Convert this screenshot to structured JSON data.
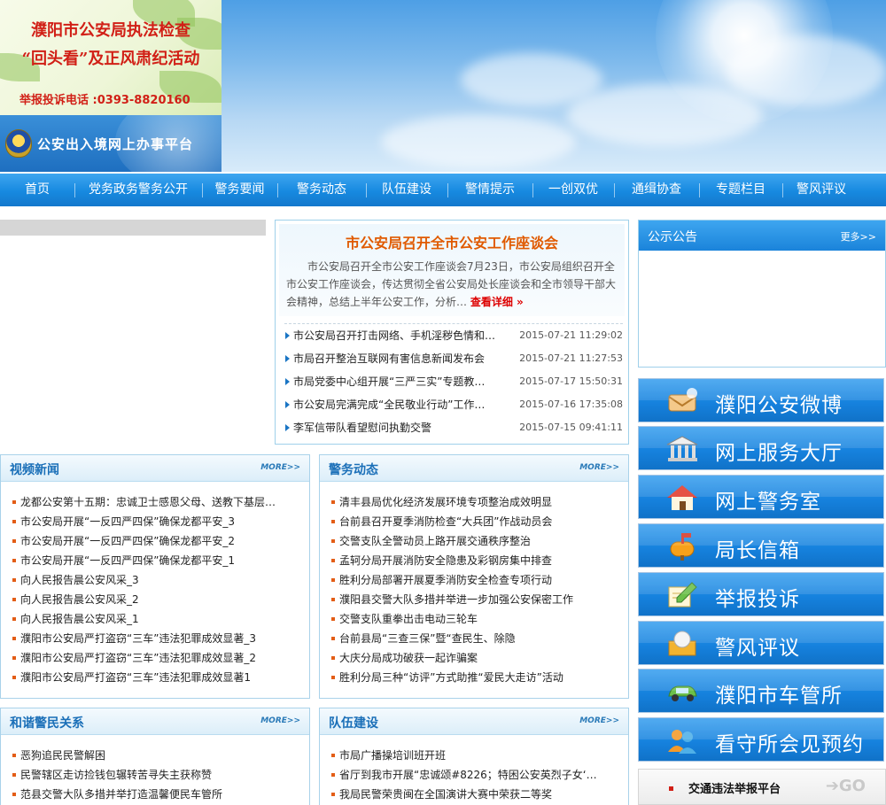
{
  "banner": {
    "line1": "濮阳市公安局执法检查",
    "line2": "“回头看”及正风肃纪活动",
    "phone": "举报投诉电话 :0393-8820160",
    "exit_entry": "公安出入境网上办事平台"
  },
  "nav": [
    "首页",
    "党务政务警务公开",
    "警务要闻",
    "警务动态",
    "队伍建设",
    "警情提示",
    "一创双优",
    "通缉协查",
    "专题栏目",
    "警风评议"
  ],
  "headline": {
    "title": "市公安局召开全市公安工作座谈会",
    "summary": "市公安局召开全市公安工作座谈会7月23日，市公安局组织召开全市公安工作座谈会，传达贯彻全省公安局处长座谈会和全市领导干部大会精神，总结上半年公安工作，分析…",
    "more": "查看详细",
    "items": [
      {
        "title": "市公安局召开打击网络、手机淫秽色情和…",
        "date": "2015-07-21 11:29:02"
      },
      {
        "title": "市局召开整治互联网有害信息新闻发布会",
        "date": "2015-07-21 11:27:53"
      },
      {
        "title": "市局党委中心组开展“三严三实”专题教…",
        "date": "2015-07-17 15:50:31"
      },
      {
        "title": "市公安局完满完成“全民敬业行动”工作…",
        "date": "2015-07-16 17:35:08"
      },
      {
        "title": "李军信带队看望慰问执勤交警",
        "date": "2015-07-15 09:41:11"
      }
    ]
  },
  "notice": {
    "title": "公示公告",
    "more": "更多>>"
  },
  "more_label": "MORE>>",
  "services": [
    {
      "label": "濮阳公安微博",
      "icon": "weibo-icon",
      "glyph": "✉",
      "color": "#f1c27d"
    },
    {
      "label": "网上服务大厅",
      "icon": "building-icon",
      "glyph": "🏛",
      "color": "#e8e8e8"
    },
    {
      "label": "网上警务室",
      "icon": "house-icon",
      "glyph": "⌂",
      "color": "#fff3d6"
    },
    {
      "label": "局长信箱",
      "icon": "mailbox-icon",
      "glyph": "✉",
      "color": "#f7a11a"
    },
    {
      "label": "举报投诉",
      "icon": "pen-icon",
      "glyph": "✎",
      "color": "#f9e6a2"
    },
    {
      "label": "警风评议",
      "icon": "comment-icon",
      "glyph": "✍",
      "color": "#f3b32e"
    },
    {
      "label": "濮阳市车管所",
      "icon": "car-icon",
      "glyph": "🚗",
      "color": "#6cc04a"
    },
    {
      "label": "看守所会见预约",
      "icon": "people-icon",
      "glyph": "👥",
      "color": "#f39a2a"
    }
  ],
  "traffic": {
    "label": "交通违法举报平台",
    "go": "➔GO"
  },
  "video_news": {
    "title": "视频新闻",
    "items": [
      "龙都公安第十五期：忠诚卫士感恩父母、送教下基层…",
      "市公安局开展“一反四严四保”确保龙都平安_3",
      "市公安局开展“一反四严四保”确保龙都平安_2",
      "市公安局开展“一反四严四保”确保龙都平安_1",
      "向人民报告晨公安风采_3",
      "向人民报告晨公安风采_2",
      "向人民报告晨公安风采_1",
      "濮阳市公安局严打盗窃“三车”违法犯罪成效显著_3",
      "濮阳市公安局严打盗窃“三车”违法犯罪成效显著_2",
      "濮阳市公安局严打盗窃“三车”违法犯罪成效显著1"
    ]
  },
  "police_news": {
    "title": "警务动态",
    "items": [
      "清丰县局优化经济发展环境专项整治成效明显",
      "台前县召开夏季消防检查“大兵团”作战动员会",
      "交警支队全警动员上路开展交通秩序整治",
      "孟轲分局开展消防安全隐患及彩钢房集中排查",
      "胜利分局部署开展夏季消防安全检查专项行动",
      "濮阳县交警大队多措并举进一步加强公安保密工作",
      "交警支队重拳出击电动三轮车",
      "台前县局“三查三保”暨“查民生、除隐",
      "大庆分局成功破获一起诈骗案",
      "胜利分局三种“访评”方式助推“爱民大走访”活动"
    ]
  },
  "harmony": {
    "title": "和谐警民关系",
    "items": [
      "恶狗追民民警解困",
      "民警辖区走访捡钱包辗转苦寻失主获称赞",
      "范县交警大队多措并举打造温馨便民车管所"
    ]
  },
  "team": {
    "title": "队伍建设",
    "items": [
      "市局广播操培训班开班",
      "省厅到我市开展“忠诚颂#8226；特困公安英烈子女‘…",
      "我局民警荣贵闽在全国演讲大赛中荣获二等奖"
    ]
  }
}
